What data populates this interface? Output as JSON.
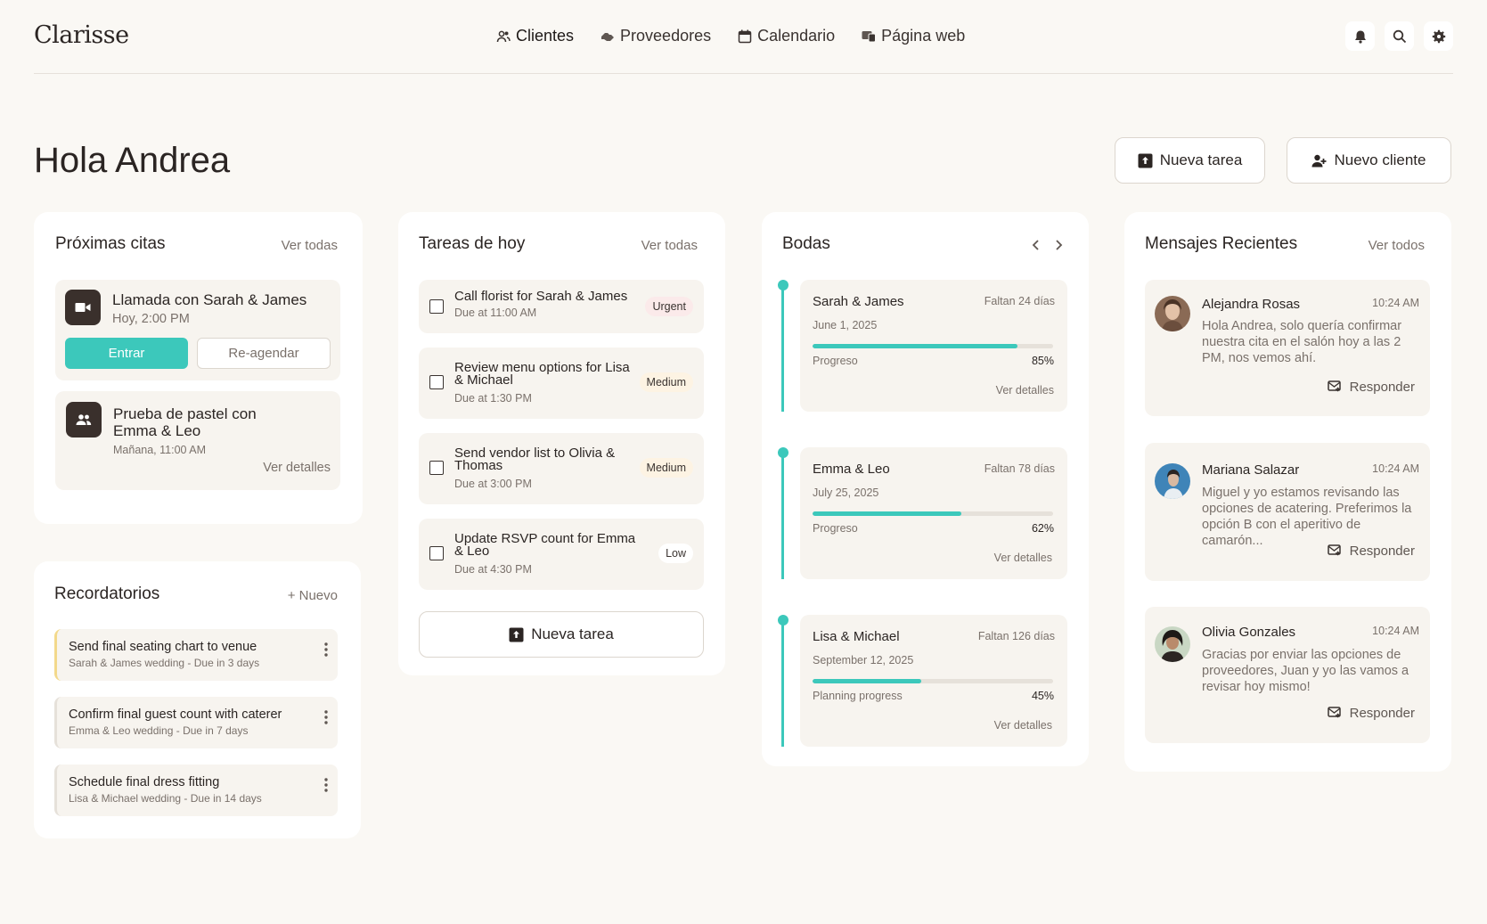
{
  "app": {
    "logo": "Clarisse"
  },
  "nav": [
    {
      "label": "Clientes",
      "icon": "users-icon"
    },
    {
      "label": "Proveedores",
      "icon": "handshake-icon"
    },
    {
      "label": "Calendario",
      "icon": "calendar-icon"
    },
    {
      "label": "Página web",
      "icon": "web-icon"
    }
  ],
  "top_icons": [
    "bell-icon",
    "search-icon",
    "settings-icon"
  ],
  "greeting": "Hola Andrea",
  "header_buttons": {
    "new_task": "Nueva tarea",
    "new_client": "Nuevo cliente"
  },
  "appointments": {
    "title": "Próximas citas",
    "link": "Ver todas",
    "items": [
      {
        "title": "Llamada con Sarah & James",
        "time": "Hoy, 2:00 PM",
        "icon": "video-icon",
        "join": "Entrar",
        "reschedule": "Re-agendar"
      },
      {
        "title": "Prueba de pastel con Emma & Leo",
        "time": "Mañana, 11:00 AM",
        "icon": "group-icon",
        "details": "Ver detalles"
      }
    ]
  },
  "reminders": {
    "title": "Recordatorios",
    "link": "+ Nuevo",
    "items": [
      {
        "title": "Send final seating chart to venue",
        "sub": "Sarah & James wedding - Due in 3 days"
      },
      {
        "title": "Confirm final guest count with caterer",
        "sub": "Emma & Leo wedding - Due in 7 days"
      },
      {
        "title": "Schedule final dress fitting",
        "sub": "Lisa & Michael wedding - Due in 14 days"
      }
    ]
  },
  "tasks": {
    "title": "Tareas de hoy",
    "link": "Ver todas",
    "items": [
      {
        "title": "Call florist for Sarah & James",
        "due": "Due at 11:00 AM",
        "priority": "Urgent"
      },
      {
        "title": "Review menu options for Lisa & Michael",
        "due": "Due at 1:30 PM",
        "priority": "Medium"
      },
      {
        "title": "Send vendor list to Olivia & Thomas",
        "due": "Due at 3:00 PM",
        "priority": "Medium"
      },
      {
        "title": "Update RSVP count for Emma & Leo",
        "due": "Due at 4:30 PM",
        "priority": "Low"
      }
    ],
    "new_task": "Nueva tarea"
  },
  "weddings": {
    "title": "Bodas",
    "items": [
      {
        "name": "Sarah & James",
        "days": "Faltan 24 días",
        "date": "June 1, 2025",
        "progress_label": "Progreso",
        "progress": 85,
        "progress_text": "85%",
        "details": "Ver detalles"
      },
      {
        "name": "Emma & Leo",
        "days": "Faltan 78 días",
        "date": "July 25, 2025",
        "progress_label": "Progreso",
        "progress": 62,
        "progress_text": "62%",
        "details": "Ver detalles"
      },
      {
        "name": "Lisa & Michael",
        "days": "Faltan 126 días",
        "date": "September 12, 2025",
        "progress_label": "Planning progress",
        "progress": 45,
        "progress_text": "45%",
        "details": "Ver detalles"
      }
    ]
  },
  "messages": {
    "title": "Mensajes Recientes",
    "link": "Ver todos",
    "reply": "Responder",
    "items": [
      {
        "name": "Alejandra Rosas",
        "time": "10:24 AM",
        "text": "Hola Andrea, solo quería confirmar nuestra cita en el salón hoy a las 2 PM, nos vemos ahí."
      },
      {
        "name": "Mariana Salazar",
        "time": "10:24 AM",
        "text": "Miguel y yo estamos revisando las opciones de acatering. Preferimos la opción B con el aperitivo de camarón..."
      },
      {
        "name": "Olivia Gonzales",
        "time": "10:24 AM",
        "text": "Gracias por enviar las opciones de proveedores, Juan y yo las vamos a revisar hoy mismo!"
      }
    ]
  },
  "colors": {
    "accent": "#3cc8bb",
    "dark": "#3a302c",
    "background": "#faf8f4",
    "urgent_bg": "#fbeaea",
    "medium_bg": "#fdf3e3"
  }
}
